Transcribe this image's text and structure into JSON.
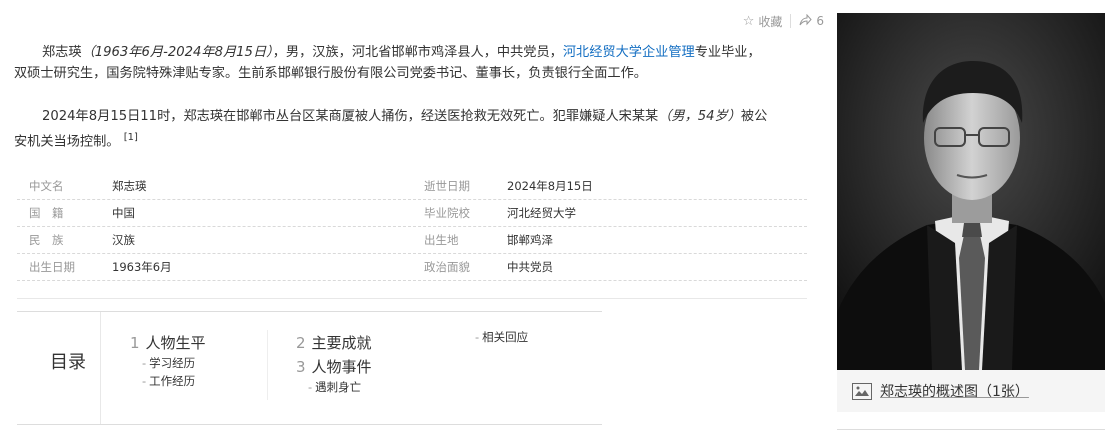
{
  "actions": {
    "collect_label": "收藏",
    "share_count": "6"
  },
  "intro": {
    "name": "郑志瑛",
    "dates": "（1963年6月-2024年8月15日）",
    "mid1": "，男，汉族，河北省邯郸市鸡泽县人，中共党员，",
    "school_link": "河北经贸大学",
    "major_link": "企业管理",
    "line1_end": "专业毕业，",
    "line2": "双硕士研究生，国务院特殊津贴专家。生前系邯郸银行股份有限公司党委书记、董事长，负责银行全面工作。"
  },
  "event": {
    "text1": "2024年8月15日11时，郑志瑛在邯郸市丛台区某商厦被人捅伤，经送医抢救无效死亡。犯罪嫌疑人宋某某",
    "suspect": "（男，54岁）",
    "text2": "被公",
    "line2": "安机关当场控制。",
    "ref": "[1]"
  },
  "info": [
    {
      "k1": "中文名",
      "v1": "郑志瑛",
      "k2": "逝世日期",
      "v2": "2024年8月15日"
    },
    {
      "k1": "国　籍",
      "v1": "中国",
      "k2": "毕业院校",
      "v2": "河北经贸大学"
    },
    {
      "k1": "民　族",
      "v1": "汉族",
      "k2": "出生地",
      "v2": "邯郸鸡泽"
    },
    {
      "k1": "出生日期",
      "v1": "1963年6月",
      "k2": "政治面貌",
      "v2": "中共党员"
    }
  ],
  "toc": {
    "title": "目录",
    "sections": [
      {
        "num": "1",
        "label": "人物生平",
        "subs": [
          "学习经历",
          "工作经历"
        ]
      },
      {
        "num": "2",
        "label": "主要成就",
        "subs": []
      },
      {
        "num": "3",
        "label": "人物事件",
        "subs": [
          "遇刺身亡"
        ]
      }
    ],
    "extra_sub": "相关回应"
  },
  "album": {
    "caption": "郑志瑛的概述图（1张）"
  },
  "colors": {
    "link": "#136ec2",
    "label_gray": "#999999"
  }
}
